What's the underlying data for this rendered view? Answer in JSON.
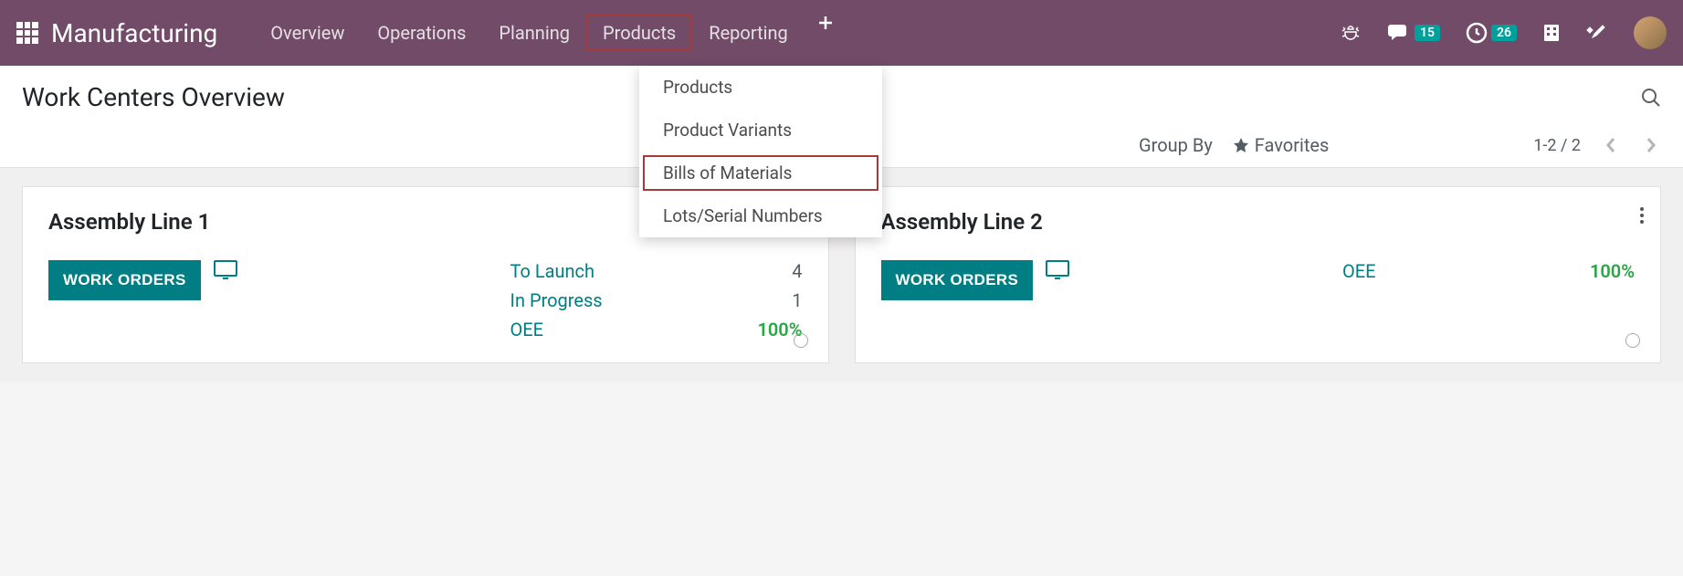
{
  "header": {
    "brand": "Manufacturing",
    "nav": [
      "Overview",
      "Operations",
      "Planning",
      "Products",
      "Reporting"
    ],
    "active_nav_index": 3,
    "notifications": {
      "discuss": "15",
      "activities": "26"
    }
  },
  "dropdown": {
    "items": [
      "Products",
      "Product Variants",
      "Bills of Materials",
      "Lots/Serial Numbers"
    ],
    "highlighted_index": 2
  },
  "control_panel": {
    "title": "Work Centers Overview",
    "group_by": "Group By",
    "favorites": "Favorites",
    "pager": "1-2 / 2"
  },
  "cards": [
    {
      "title": "Assembly Line 1",
      "button": "WORK ORDERS",
      "stats": [
        {
          "label": "To Launch",
          "val": "4",
          "green": false
        },
        {
          "label": "In Progress",
          "val": "1",
          "green": false
        },
        {
          "label": "OEE",
          "val": "100%",
          "green": true
        }
      ],
      "show_dots_menu": false
    },
    {
      "title": "Assembly Line 2",
      "button": "WORK ORDERS",
      "stats": [
        {
          "label": "OEE",
          "val": "100%",
          "green": true
        }
      ],
      "show_dots_menu": true
    }
  ]
}
